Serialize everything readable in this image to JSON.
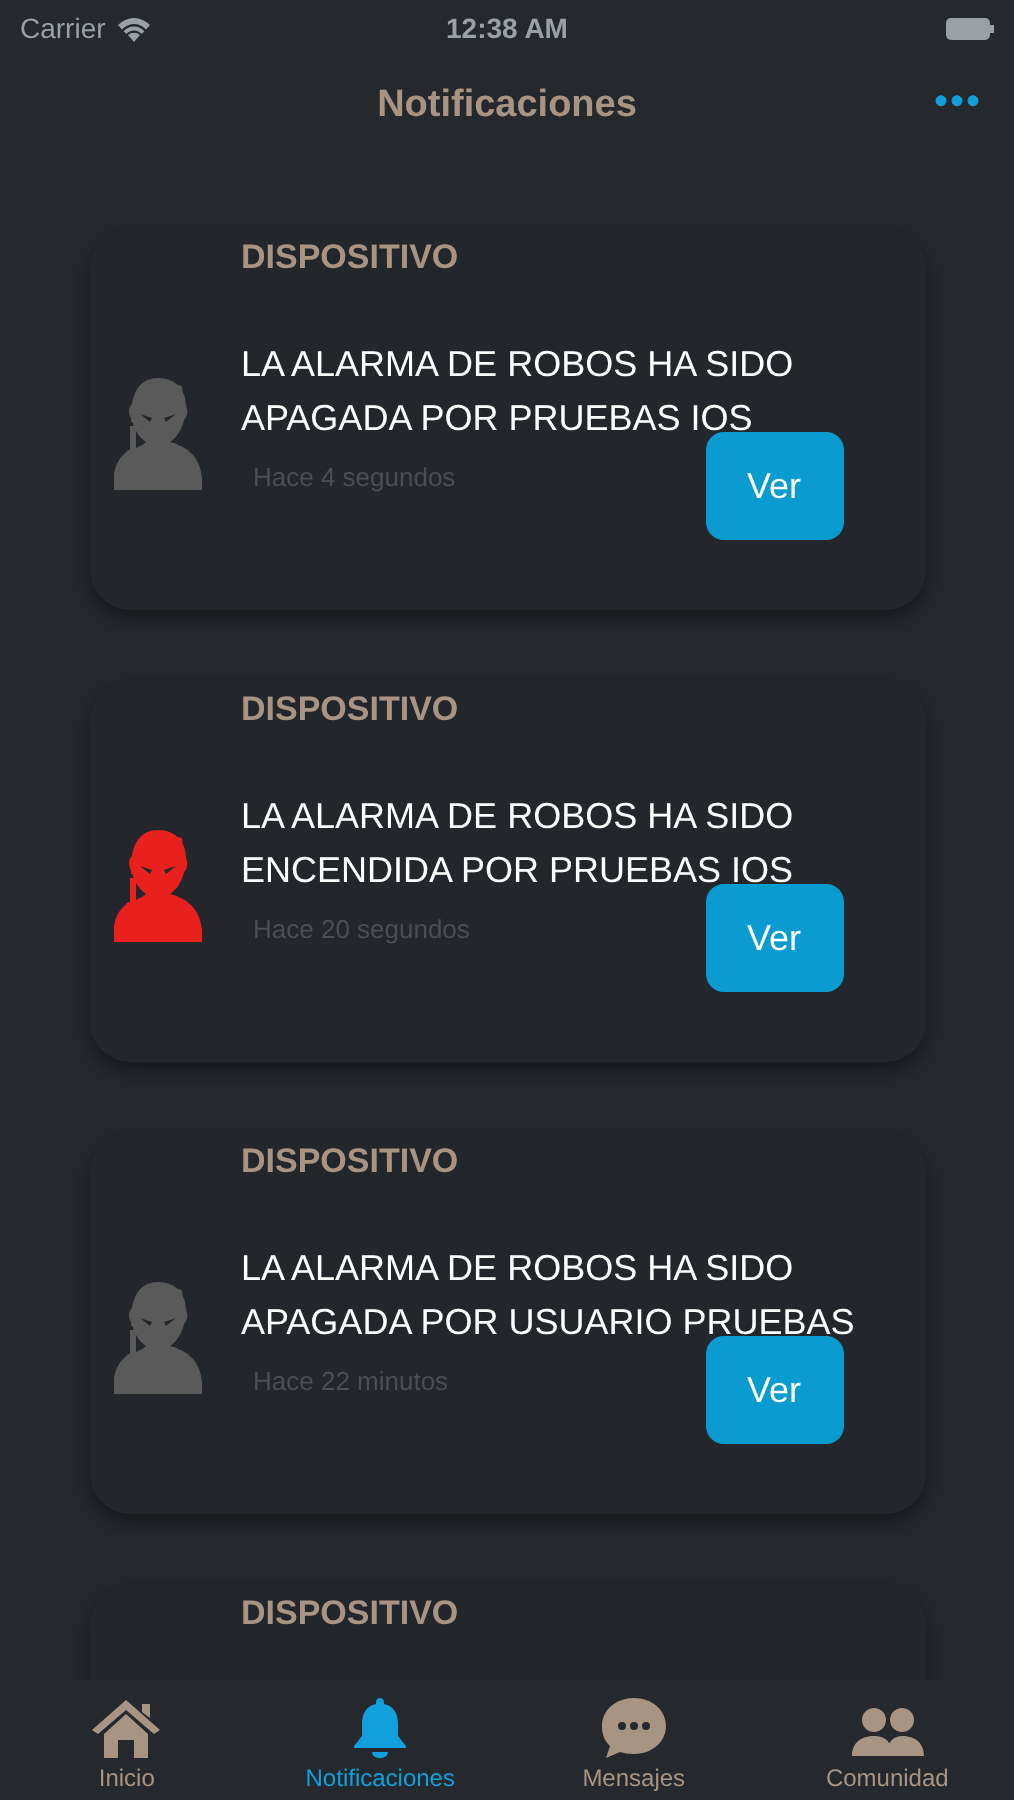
{
  "status_bar": {
    "carrier": "Carrier",
    "time": "12:38 AM"
  },
  "nav": {
    "title": "Notificaciones",
    "more": "•••"
  },
  "notifications": [
    {
      "category": "DISPOSITIVO",
      "message": "LA ALARMA DE ROBOS HA SIDO APAGADA POR PRUEBAS IOS",
      "time": "Hace 4 segundos",
      "alarm_on": false,
      "button": "Ver"
    },
    {
      "category": "DISPOSITIVO",
      "message": "LA ALARMA DE ROBOS HA SIDO ENCENDIDA POR PRUEBAS IOS",
      "time": "Hace 20 segundos",
      "alarm_on": true,
      "button": "Ver"
    },
    {
      "category": "DISPOSITIVO",
      "message": "LA ALARMA DE ROBOS HA SIDO APAGADA POR USUARIO PRUEBAS",
      "time": "Hace 22 minutos",
      "alarm_on": false,
      "button": "Ver"
    },
    {
      "category": "DISPOSITIVO"
    }
  ],
  "tabs": [
    {
      "kind": "home",
      "label": "Inicio",
      "selected": false
    },
    {
      "kind": "bell",
      "label": "Notificaciones",
      "selected": true
    },
    {
      "kind": "chat",
      "label": "Mensajes",
      "selected": false
    },
    {
      "kind": "people",
      "label": "Comunidad",
      "selected": false
    }
  ]
}
